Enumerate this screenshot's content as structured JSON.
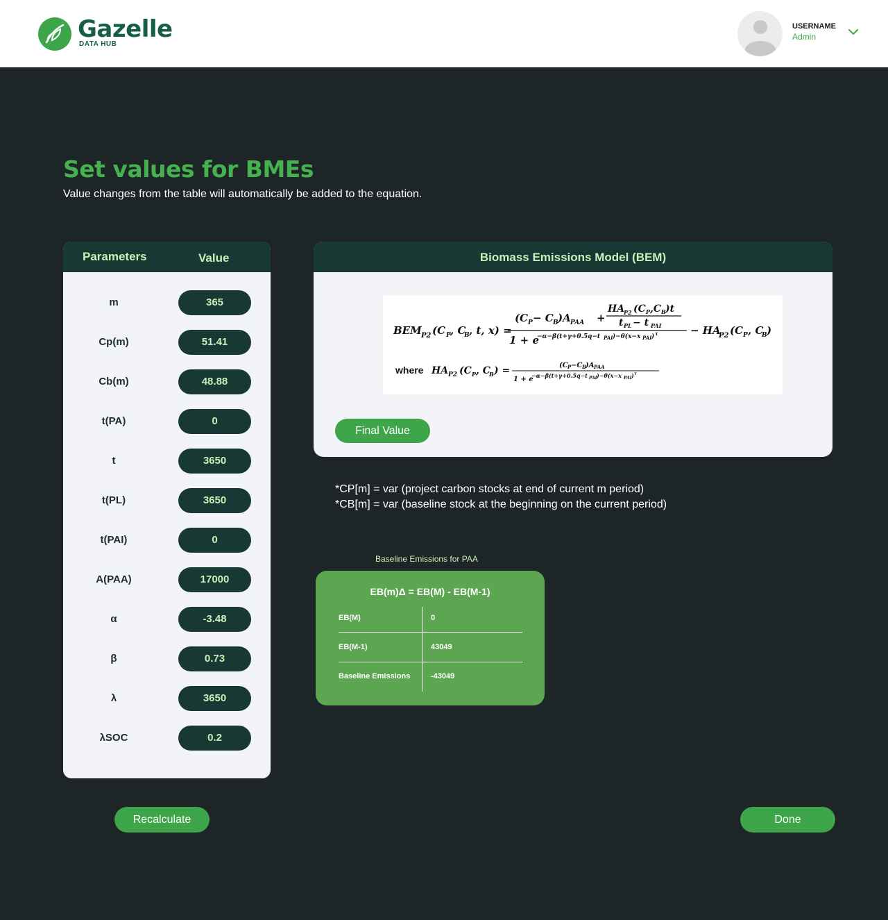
{
  "header": {
    "brand": "Gazelle",
    "brand_sub": "DATA HUB",
    "username": "USERNAME",
    "role": "Admin"
  },
  "page": {
    "title": "Set values for BMEs",
    "subtitle": "Value changes from the table will automatically be added to the equation."
  },
  "params": {
    "col_param": "Parameters",
    "col_value": "Value",
    "rows": [
      {
        "label": "m",
        "value": "365"
      },
      {
        "label": "Cp(m)",
        "value": "51.41"
      },
      {
        "label": "Cb(m)",
        "value": "48.88"
      },
      {
        "label": "t(PA)",
        "value": "0"
      },
      {
        "label": "t",
        "value": "3650"
      },
      {
        "label": "t(PL)",
        "value": "3650"
      },
      {
        "label": "t(PAI)",
        "value": "0"
      },
      {
        "label": "A(PAA)",
        "value": "17000"
      },
      {
        "label": "α",
        "value": "-3.48"
      },
      {
        "label": "β",
        "value": "0.73"
      },
      {
        "label": "λ",
        "value": "3650"
      },
      {
        "label": "λSOC",
        "value": "0.2"
      }
    ]
  },
  "bem": {
    "title": "Biomass Emissions Model (BEM)",
    "final_label": "Final Value",
    "formula": {
      "lhs": "BEM",
      "lhs_sub": "P2",
      "lhs_args": "(C",
      "where": "where"
    }
  },
  "notes": {
    "line1": "*CP[m] = var (project carbon stocks at end of current m period)",
    "line2": "*CB[m] = var (baseline stock at the beginning on the current period)"
  },
  "baseline": {
    "title": "Baseline Emissions for PAA",
    "equation": "EB(m)Δ = EB(M) - EB(M-1)",
    "rows": [
      {
        "label": "EB(M)",
        "value": "0"
      },
      {
        "label": "EB(M-1)",
        "value": "43049"
      },
      {
        "label": "Baseline Emissions",
        "value": "-43049"
      }
    ]
  },
  "actions": {
    "recalculate": "Recalculate",
    "done": "Done"
  },
  "colors": {
    "accent": "#3fa54a",
    "dark": "#173833",
    "background": "#1d2526"
  }
}
